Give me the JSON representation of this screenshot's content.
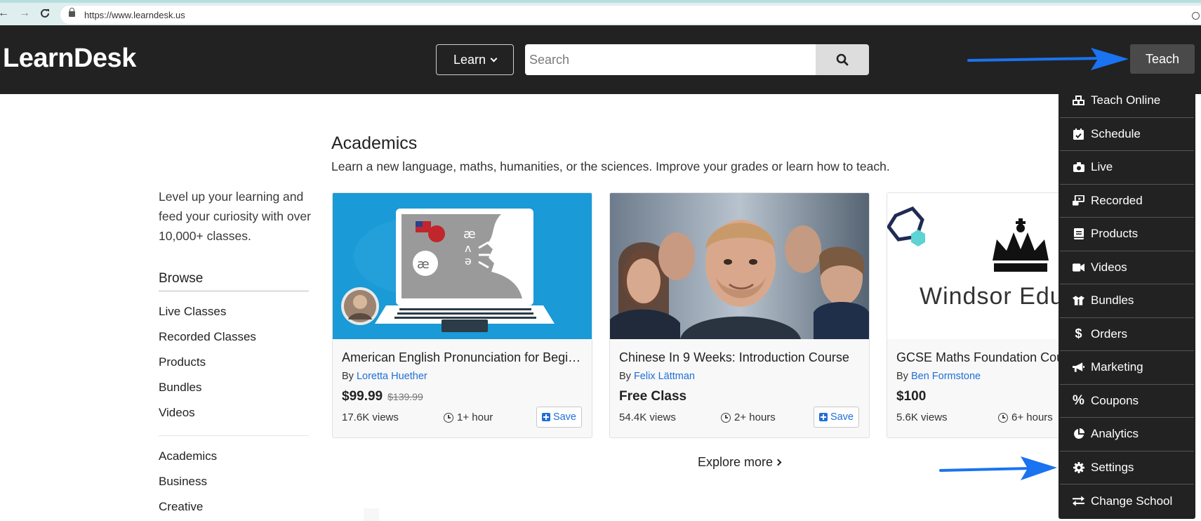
{
  "browser": {
    "url": "https://www.learndesk.us"
  },
  "header": {
    "logo": "LearnDesk",
    "learn_label": "Learn",
    "search_placeholder": "Search",
    "teach_label": "Teach"
  },
  "sidebar": {
    "tagline": "Level up your learning and feed your curiosity with over 10,000+ classes.",
    "browse_heading": "Browse",
    "browse_items": [
      "Live Classes",
      "Recorded Classes",
      "Products",
      "Bundles",
      "Videos"
    ],
    "category_items": [
      "Academics",
      "Business",
      "Creative"
    ]
  },
  "main": {
    "section_title": "Academics",
    "section_subtitle": "Learn a new language, maths, humanities, or the sciences. Improve your grades or learn how to teach.",
    "cards": [
      {
        "title": "American English Pronunciation for Beginners",
        "by_prefix": "By",
        "author": "Loretta Huether",
        "price": "$99.99",
        "old_price": "$139.99",
        "views": "17.6K views",
        "duration": "1+ hour",
        "save_label": "Save"
      },
      {
        "title": "Chinese In 9 Weeks: Introduction Course",
        "by_prefix": "By",
        "author": "Felix Lättman",
        "price": "Free Class",
        "views": "54.4K views",
        "duration": "2+ hours",
        "save_label": "Save"
      },
      {
        "title": "GCSE Maths Foundation Course",
        "by_prefix": "By",
        "author": "Ben Formstone",
        "price": "$100",
        "views": "5.6K views",
        "duration": "6+ hours",
        "image_text": "Windsor Educ"
      }
    ],
    "explore_label": "Explore more"
  },
  "teach_menu": {
    "items": [
      {
        "label": "Teach Online",
        "icon": "cubes-icon"
      },
      {
        "label": "Schedule",
        "icon": "calendar-check-icon"
      },
      {
        "label": "Live",
        "icon": "camera-icon"
      },
      {
        "label": "Recorded",
        "icon": "laptop-video-icon"
      },
      {
        "label": "Products",
        "icon": "book-icon"
      },
      {
        "label": "Videos",
        "icon": "video-icon"
      },
      {
        "label": "Bundles",
        "icon": "box-icon"
      },
      {
        "label": "Orders",
        "icon": "dollar-icon"
      },
      {
        "label": "Marketing",
        "icon": "bullhorn-icon"
      },
      {
        "label": "Coupons",
        "icon": "percent-icon"
      },
      {
        "label": "Analytics",
        "icon": "pie-chart-icon"
      },
      {
        "label": "Settings",
        "icon": "gear-icon"
      },
      {
        "label": "Change School",
        "icon": "exchange-icon"
      }
    ]
  },
  "colors": {
    "header_bg": "#222222",
    "link_blue": "#1f6fd6",
    "annotation_arrow": "#1a73f0"
  }
}
